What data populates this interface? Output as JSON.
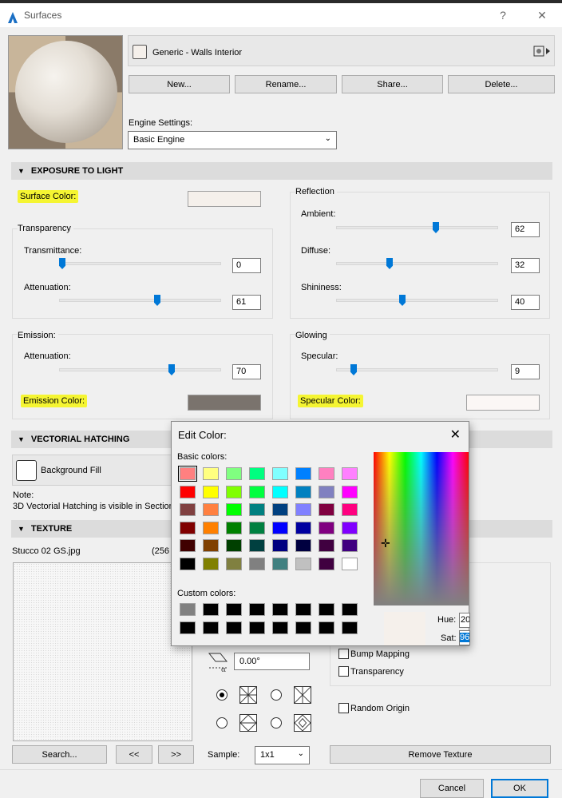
{
  "window": {
    "title": "Surfaces",
    "help": "?",
    "close": "✕"
  },
  "material": {
    "name": "Generic - Walls Interior"
  },
  "buttons": {
    "new": "New...",
    "rename": "Rename...",
    "share": "Share...",
    "delete": "Delete..."
  },
  "engine": {
    "label": "Engine Settings:",
    "value": "Basic Engine"
  },
  "exposure": {
    "header": "EXPOSURE TO LIGHT",
    "surface_color_label": "Surface Color:",
    "surface_color": "#f5f0eb",
    "transparency": {
      "label": "Transparency",
      "transmittance_label": "Transmittance:",
      "transmittance": "0",
      "attenuation_label": "Attenuation:",
      "attenuation": "61"
    },
    "reflection": {
      "label": "Reflection",
      "ambient_label": "Ambient:",
      "ambient": "62",
      "diffuse_label": "Diffuse:",
      "diffuse": "32",
      "shininess_label": "Shininess:",
      "shininess": "40"
    },
    "emission": {
      "label": "Emission:",
      "attenuation_label": "Attenuation:",
      "attenuation": "70",
      "color_label": "Emission Color:",
      "color": "#7a736d"
    },
    "glowing": {
      "label": "Glowing",
      "specular_label": "Specular:",
      "specular": "9",
      "color_label": "Specular Color:",
      "color": "#fbf7f5"
    }
  },
  "hatching": {
    "header": "VECTORIAL HATCHING",
    "background_fill": "Background Fill",
    "note_label": "Note:",
    "note_text": "3D Vectorial Hatching is visible in Section"
  },
  "texture": {
    "header": "TEXTURE",
    "file": "Stucco 02 GS.jpg",
    "size": "(256",
    "angle": "0.00°",
    "bump_mapping": "Bump Mapping",
    "transparency": "Transparency",
    "random_origin": "Random Origin",
    "search": "Search...",
    "prev": "<<",
    "next": ">>",
    "sample_label": "Sample:",
    "sample_value": "1x1",
    "remove": "Remove Texture"
  },
  "footer": {
    "cancel": "Cancel",
    "ok": "OK"
  },
  "edit_color": {
    "title": "Edit Color:",
    "basic_label": "Basic colors:",
    "custom_label": "Custom colors:",
    "hue_label": "Hue:",
    "hue_value": "20",
    "sat_label": "Sat:",
    "sat_value": "96",
    "basic_colors": [
      "#ff8080",
      "#ffff80",
      "#80ff80",
      "#00ff80",
      "#80ffff",
      "#0080ff",
      "#ff80c0",
      "#ff80ff",
      "#ff0000",
      "#ffff00",
      "#80ff00",
      "#00ff40",
      "#00ffff",
      "#0080c0",
      "#8080c0",
      "#ff00ff",
      "#804040",
      "#ff8040",
      "#00ff00",
      "#008080",
      "#004080",
      "#8080ff",
      "#800040",
      "#ff0080",
      "#800000",
      "#ff8000",
      "#008000",
      "#008040",
      "#0000ff",
      "#0000a0",
      "#800080",
      "#8000ff",
      "#400000",
      "#804000",
      "#004000",
      "#004040",
      "#000080",
      "#000040",
      "#400040",
      "#400080",
      "#000000",
      "#808000",
      "#808040",
      "#808080",
      "#408080",
      "#c0c0c0",
      "#400040",
      "#ffffff"
    ],
    "custom_colors": [
      "#808080",
      "#000000",
      "#000000",
      "#000000",
      "#000000",
      "#000000",
      "#000000",
      "#000000",
      "#000000",
      "#000000",
      "#000000",
      "#000000",
      "#000000",
      "#000000",
      "#000000",
      "#000000"
    ]
  }
}
